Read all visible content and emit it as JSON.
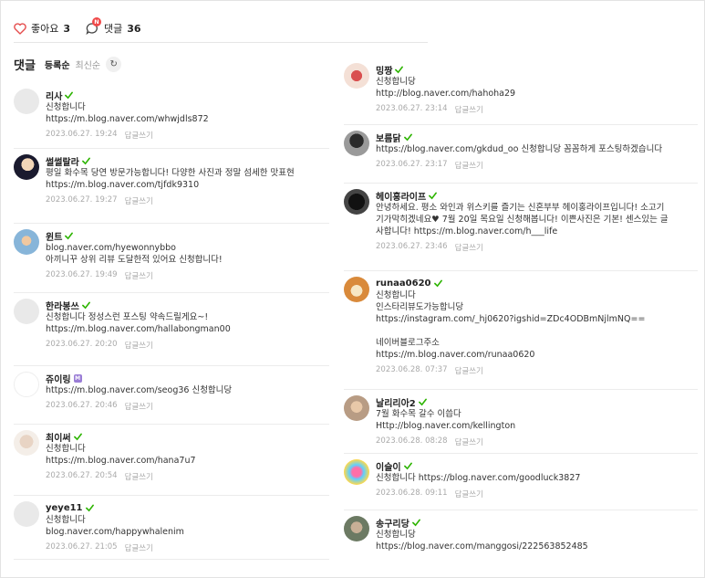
{
  "top": {
    "like_label": "좋아요",
    "like_count": "3",
    "comment_badge": "N",
    "comment_label": "댓글",
    "comment_count": "36"
  },
  "sort": {
    "title": "댓글",
    "registered": "등록순",
    "latest": "최신순",
    "refresh_icon": "↻"
  },
  "reply_label": "답글쓰기",
  "colors": {
    "accent_green": "#2db400",
    "heart_red": "#e54d4d"
  },
  "left_comments": [
    {
      "author": "리사",
      "lines": [
        "신청합니다",
        "https://m.blog.naver.com/whwjdls872"
      ],
      "time": "2023.06.27. 19:24"
    },
    {
      "author": "썰썰랄라",
      "lines": [
        "평일 화수목 당연 방문가능합니다! 다양한 사진과 정말 섬세한 맛표현",
        "https://m.blog.naver.com/tjfdk9310"
      ],
      "time": "2023.06.27. 19:27"
    },
    {
      "author": "윈트",
      "lines": [
        "blog.naver.com/hyewonnybbo",
        "아끼니꾸 상위 리뷰 도달한적 있어요 신청합니다!"
      ],
      "time": "2023.06.27. 19:49"
    },
    {
      "author": "한라봉쓰",
      "lines": [
        "신청합니다 정성스런 포스팅 약속드릴게요~!",
        "https://m.blog.naver.com/hallabongman00"
      ],
      "time": "2023.06.27. 20:20"
    },
    {
      "author": "쥬이링",
      "lines": [
        "https://m.blog.naver.com/seog36 신청합니당"
      ],
      "time": "2023.06.27. 20:46",
      "badge": "M"
    },
    {
      "author": "최이써",
      "lines": [
        "신청합니다",
        "https://m.blog.naver.com/hana7u7"
      ],
      "time": "2023.06.27. 20:54"
    },
    {
      "author": "yeye11",
      "lines": [
        "신청합니다",
        "blog.naver.com/happywhalenim"
      ],
      "time": "2023.06.27. 21:05"
    }
  ],
  "right_comments": [
    {
      "author": "밍짱",
      "lines": [
        "신청합니당",
        "http://blog.naver.com/hahoha29"
      ],
      "time": "2023.06.27. 23:14"
    },
    {
      "author": "보름닭",
      "lines": [
        "https://blog.naver.com/gkdud_oo 신청합니당 꼼꼼하게 포스팅하겠습니다"
      ],
      "time": "2023.06.27. 23:17"
    },
    {
      "author": "헤이홍라이프",
      "lines": [
        "안녕하세요. 평소 와인과 위스키를 즐기는 신혼부부 헤이홍라이프입니다! 소고기",
        "기가막히겠네요♥ 7월 20일 목요일 신청해봅니다! 이쁜사진은 기본! 센스있는 글",
        "사합니다! https://m.blog.naver.com/h___life"
      ],
      "time": "2023.06.27. 23:46"
    },
    {
      "author": "runaa0620",
      "lines": [
        "신청합니다",
        "인스타리뷰도가능합니당",
        "https://instagram.com/_hj0620?igshid=ZDc4ODBmNjlmNQ==",
        "",
        "네이버블로그주소",
        "https://m.blog.naver.com/runaa0620"
      ],
      "time": "2023.06.28. 07:37"
    },
    {
      "author": "날리리아2",
      "lines": [
        "7월 화수목 갈수 이씁다",
        "Http://blog.naver.com/kellington"
      ],
      "time": "2023.06.28. 08:28"
    },
    {
      "author": "이슬이",
      "lines": [
        "신청합니다 https://blog.naver.com/goodluck3827"
      ],
      "time": "2023.06.28. 09:11"
    },
    {
      "author": "송구리당",
      "lines": [
        "신청합니당",
        "https://blog.naver.com/manggosi/222563852485"
      ],
      "time": ""
    }
  ]
}
